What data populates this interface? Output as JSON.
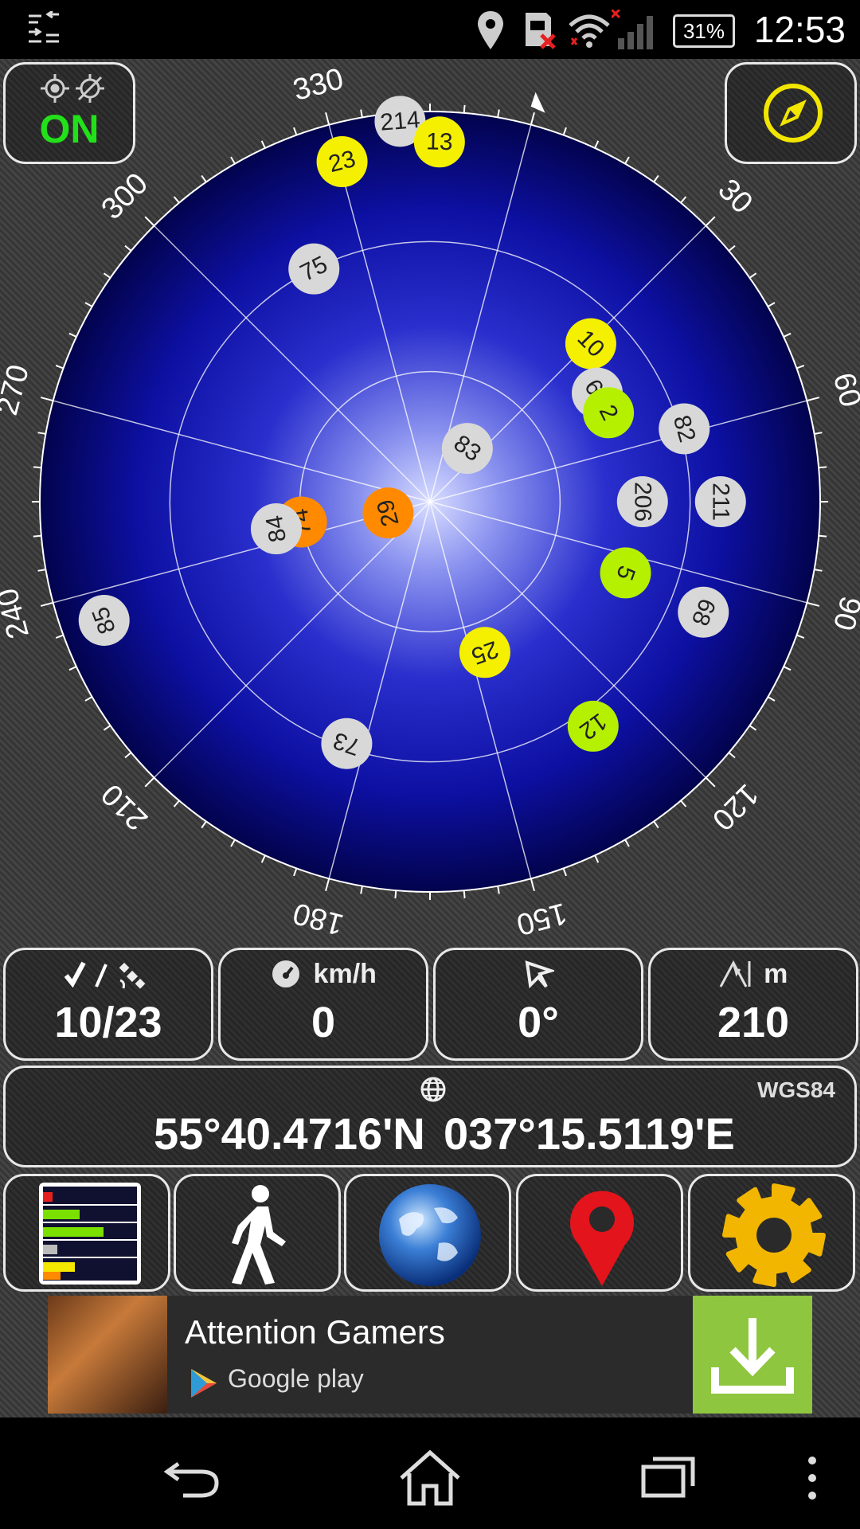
{
  "status_bar": {
    "time": "12:53",
    "battery": "31%",
    "icons": [
      "notification-icon",
      "location-icon",
      "sd-card-icon",
      "wifi-icon",
      "signal-icon",
      "battery-icon"
    ]
  },
  "gps_toggle": {
    "label": "ON",
    "color": "#22e01a"
  },
  "compass_button": {
    "icon": "compass-icon",
    "color": "#f2e600"
  },
  "sky_plot": {
    "bearing_labels": [
      "30",
      "60",
      "90",
      "120",
      "150",
      "180",
      "210",
      "240",
      "270",
      "300",
      "330"
    ],
    "satellites": [
      {
        "id": "214",
        "az": 340.5,
        "el": 2,
        "color": "#d8d8d8"
      },
      {
        "id": "13",
        "az": 346.5,
        "el": 7,
        "color": "#f4f000"
      },
      {
        "id": "23",
        "az": 330.5,
        "el": 9,
        "color": "#f4f000"
      },
      {
        "id": "75",
        "az": 318.5,
        "el": 30,
        "color": "#d8d8d8"
      },
      {
        "id": "10",
        "az": 30.5,
        "el": 38,
        "color": "#f4f000"
      },
      {
        "id": "67",
        "az": 42,
        "el": 44,
        "color": "#d8d8d8"
      },
      {
        "id": "2",
        "az": 48.5,
        "el": 44,
        "color": "#b5f000"
      },
      {
        "id": "82",
        "az": 59,
        "el": 29,
        "color": "#d8d8d8"
      },
      {
        "id": "211",
        "az": 75,
        "el": 23,
        "color": "#d8d8d8"
      },
      {
        "id": "206",
        "az": 75,
        "el": 41,
        "color": "#d8d8d8"
      },
      {
        "id": "5",
        "az": 95,
        "el": 42,
        "color": "#b5f000"
      },
      {
        "id": "68",
        "az": 97,
        "el": 22,
        "color": "#d8d8d8"
      },
      {
        "id": "83",
        "az": 20,
        "el": 75,
        "color": "#d8d8d8"
      },
      {
        "id": "29",
        "az": 240,
        "el": 80,
        "color": "#ff8a00"
      },
      {
        "id": "74",
        "az": 246,
        "el": 60,
        "color": "#ff8a00"
      },
      {
        "id": "84",
        "az": 245,
        "el": 54,
        "color": "#d8d8d8"
      },
      {
        "id": "25",
        "az": 145,
        "el": 53,
        "color": "#f4f000"
      },
      {
        "id": "12",
        "az": 129,
        "el": 26,
        "color": "#b5f000"
      },
      {
        "id": "73",
        "az": 184,
        "el": 31,
        "color": "#d8d8d8"
      },
      {
        "id": "85",
        "az": 235,
        "el": 10,
        "color": "#d8d8d8"
      }
    ]
  },
  "stats": {
    "satellites": {
      "value": "10/23",
      "icons": [
        "check-icon",
        "satellite-icon"
      ]
    },
    "speed": {
      "unit": "km/h",
      "value": "0",
      "icon": "speedometer-icon"
    },
    "bearing": {
      "value": "0°",
      "icon": "heading-icon"
    },
    "altitude": {
      "unit": "m",
      "value": "210",
      "icon": "altitude-icon"
    }
  },
  "coordinates": {
    "datum": "WGS84",
    "latitude": "55°40.4716'N",
    "longitude": "037°15.5119'E",
    "icon": "globe-icon"
  },
  "toolbar": [
    "signal-bars-icon",
    "walking-person-icon",
    "earth-globe-icon",
    "map-pin-icon",
    "settings-gear-icon"
  ],
  "ad": {
    "title": "Attention Gamers",
    "store": "Google play",
    "button_color": "#8ec63f"
  },
  "nav_bar": [
    "back-icon",
    "home-icon",
    "recents-icon",
    "menu-icon"
  ]
}
